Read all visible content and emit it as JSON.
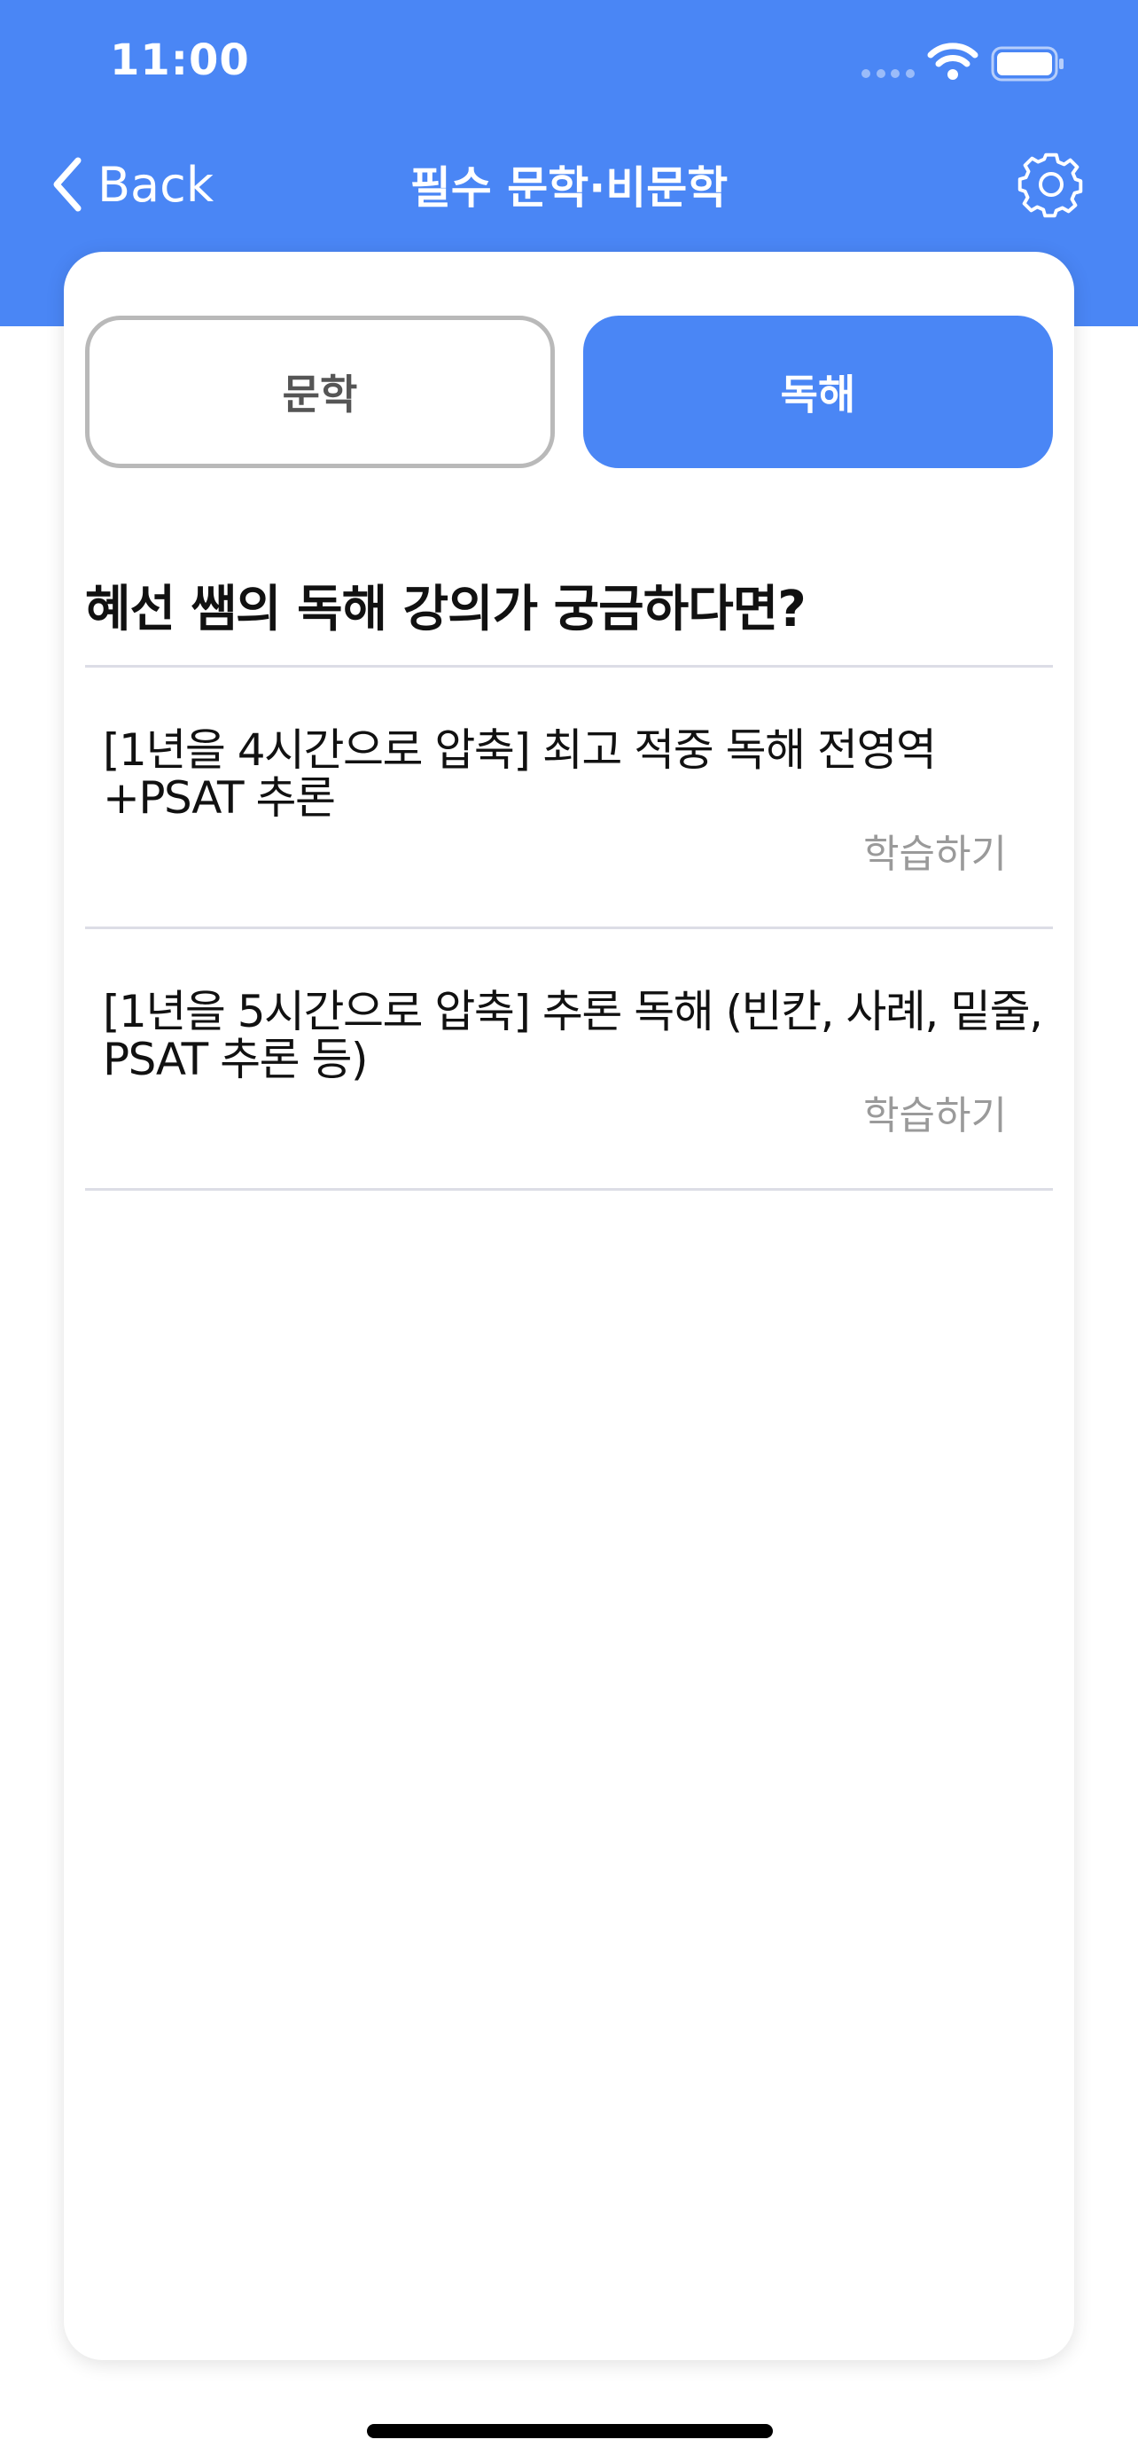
{
  "status_bar": {
    "time": "11:00"
  },
  "nav": {
    "back_label": "Back",
    "title": "필수 문학·비문학",
    "settings_icon": "gear-icon"
  },
  "tabs": [
    {
      "label": "문학",
      "selected": false
    },
    {
      "label": "독해",
      "selected": true
    }
  ],
  "section": {
    "title": "혜선 쌤의 독해 강의가 궁금하다면?"
  },
  "lessons": [
    {
      "title": "[1년을 4시간으로 압축] 최고 적중 독해 전영역+PSAT 추론",
      "action": "학습하기"
    },
    {
      "title": "[1년을 5시간으로 압축] 추론 독해 (빈칸, 사례, 밑줄, PSAT 추론 등)",
      "action": "학습하기"
    }
  ],
  "colors": {
    "accent": "#4a86f5",
    "unselected_border": "#b9b9b9",
    "muted_text": "#9a9a9a",
    "divider": "#dcdde6"
  }
}
